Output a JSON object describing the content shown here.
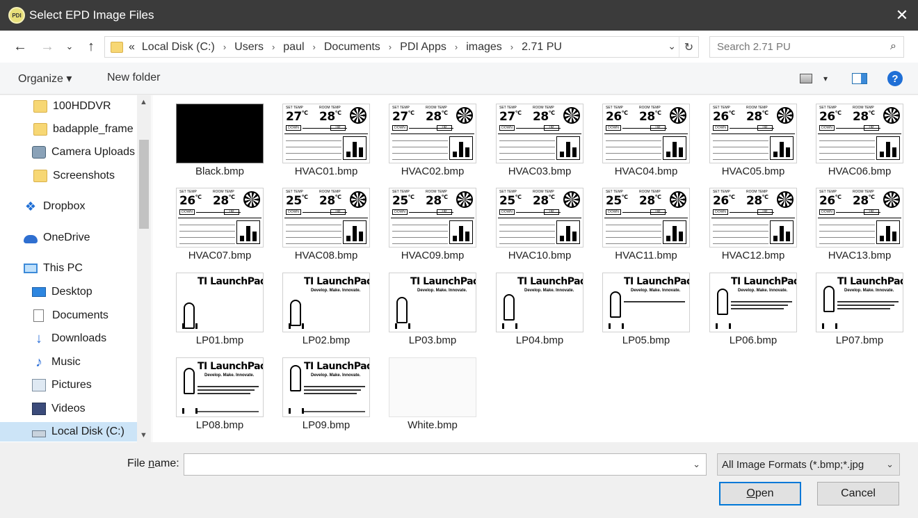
{
  "window": {
    "title": "Select EPD Image Files",
    "app_icon_text": "PDI",
    "close_glyph": "✕"
  },
  "nav": {
    "back_glyph": "←",
    "forward_glyph": "→",
    "recent_glyph": "⌄",
    "up_glyph": "↑"
  },
  "address": {
    "overflow": "«",
    "crumbs": [
      "Local Disk (C:)",
      "Users",
      "paul",
      "Documents",
      "PDI Apps",
      "images",
      "2.71 PU"
    ],
    "separator": "›",
    "dropdown_glyph": "⌄",
    "refresh_glyph": "↻"
  },
  "search": {
    "placeholder": "Search 2.71 PU",
    "icon_glyph": "⌕"
  },
  "toolbar": {
    "organize_label": "Organize ▾",
    "new_folder_label": "New folder",
    "view_dropdown_glyph": "▾",
    "help_glyph": "?"
  },
  "sidebar": {
    "scroll_up": "▲",
    "scroll_down": "▼",
    "items": [
      {
        "label": "100HDDVR",
        "icon": "folder-icon"
      },
      {
        "label": "badapple_frame",
        "icon": "folder-icon"
      },
      {
        "label": "Camera Uploads",
        "icon": "camera-icon"
      },
      {
        "label": "Screenshots",
        "icon": "folder-icon"
      },
      {
        "label": "Dropbox",
        "icon": "dropbox-icon",
        "glyph": "❖"
      },
      {
        "label": "OneDrive",
        "icon": "onedrive-icon"
      },
      {
        "label": "This PC",
        "icon": "computer-icon"
      },
      {
        "label": "Desktop",
        "icon": "desktop-icon"
      },
      {
        "label": "Documents",
        "icon": "document-icon"
      },
      {
        "label": "Downloads",
        "icon": "download-icon",
        "glyph": "↓"
      },
      {
        "label": "Music",
        "icon": "music-icon",
        "glyph": "♪"
      },
      {
        "label": "Pictures",
        "icon": "pictures-icon"
      },
      {
        "label": "Videos",
        "icon": "video-icon"
      },
      {
        "label": "Local Disk (C:)",
        "icon": "disk-icon",
        "selected": true
      }
    ]
  },
  "files": [
    {
      "name": "Black.bmp",
      "kind": "black"
    },
    {
      "name": "HVAC01.bmp",
      "kind": "hvac",
      "set": "27",
      "room": "28"
    },
    {
      "name": "HVAC02.bmp",
      "kind": "hvac",
      "set": "27",
      "room": "28"
    },
    {
      "name": "HVAC03.bmp",
      "kind": "hvac",
      "set": "27",
      "room": "28"
    },
    {
      "name": "HVAC04.bmp",
      "kind": "hvac",
      "set": "26",
      "room": "28"
    },
    {
      "name": "HVAC05.bmp",
      "kind": "hvac",
      "set": "26",
      "room": "28"
    },
    {
      "name": "HVAC06.bmp",
      "kind": "hvac",
      "set": "26",
      "room": "28"
    },
    {
      "name": "HVAC07.bmp",
      "kind": "hvac",
      "set": "26",
      "room": "28"
    },
    {
      "name": "HVAC08.bmp",
      "kind": "hvac",
      "set": "25",
      "room": "28"
    },
    {
      "name": "HVAC09.bmp",
      "kind": "hvac",
      "set": "25",
      "room": "28"
    },
    {
      "name": "HVAC10.bmp",
      "kind": "hvac",
      "set": "25",
      "room": "28"
    },
    {
      "name": "HVAC11.bmp",
      "kind": "hvac",
      "set": "25",
      "room": "28"
    },
    {
      "name": "HVAC12.bmp",
      "kind": "hvac",
      "set": "26",
      "room": "28"
    },
    {
      "name": "HVAC13.bmp",
      "kind": "hvac",
      "set": "26",
      "room": "28"
    },
    {
      "name": "LP01.bmp",
      "kind": "lp"
    },
    {
      "name": "LP02.bmp",
      "kind": "lp"
    },
    {
      "name": "LP03.bmp",
      "kind": "lp"
    },
    {
      "name": "LP04.bmp",
      "kind": "lp"
    },
    {
      "name": "LP05.bmp",
      "kind": "lp"
    },
    {
      "name": "LP06.bmp",
      "kind": "lp"
    },
    {
      "name": "LP07.bmp",
      "kind": "lp"
    },
    {
      "name": "LP08.bmp",
      "kind": "lp"
    },
    {
      "name": "LP09.bmp",
      "kind": "lp"
    },
    {
      "name": "White.bmp",
      "kind": "white"
    }
  ],
  "thumb_text": {
    "lp_title": "TI LaunchPad",
    "lp_sub": "Develop. Make. Innovate.",
    "hvac_down": "DOWN",
    "hvac_up": "UP",
    "hvac_set_label": "SET TEMP",
    "hvac_room_label": "ROOM TEMP",
    "deg": "°C"
  },
  "bottom": {
    "file_name_label_prefix": "File ",
    "file_name_label_accel": "n",
    "file_name_label_suffix": "ame:",
    "file_name_value": "",
    "combo_glyph": "⌄",
    "file_type": "All Image Formats (*.bmp;*.jpg",
    "open_accel": "O",
    "open_rest": "pen",
    "cancel_label": "Cancel"
  }
}
